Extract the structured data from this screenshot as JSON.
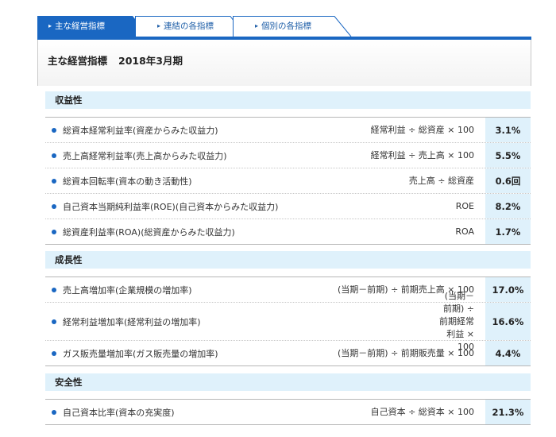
{
  "tabs": [
    {
      "label": "主な経営指標",
      "active": true
    },
    {
      "label": "連結の各指標",
      "active": false
    },
    {
      "label": "個別の各指標",
      "active": false
    }
  ],
  "header": {
    "title": "主な経営指標",
    "period": "2018年3月期"
  },
  "sections": [
    {
      "title": "収益性",
      "rows": [
        {
          "name": "総資本経常利益率(資産からみた収益力)",
          "formula": "経常利益 ÷ 総資産 × 100",
          "value": "3.1%"
        },
        {
          "name": "売上高経常利益率(売上高からみた収益力)",
          "formula": "経常利益 ÷ 売上高 × 100",
          "value": "5.5%"
        },
        {
          "name": "総資本回転率(資本の動き活動性)",
          "formula": "売上高 ÷ 総資産",
          "value": "0.6回"
        },
        {
          "name": "自己資本当期純利益率(ROE)(自己資本からみた収益力)",
          "formula": "ROE",
          "value": "8.2%"
        },
        {
          "name": "総資産利益率(ROA)(総資産からみた収益力)",
          "formula": "ROA",
          "value": "1.7%"
        }
      ]
    },
    {
      "title": "成長性",
      "rows": [
        {
          "name": "売上高増加率(企業規模の増加率)",
          "formula": "(当期－前期) ÷ 前期売上高 × 100",
          "value": "17.0%"
        },
        {
          "name": "経常利益増加率(経常利益の増加率)",
          "formula": "(当期－前期) ÷ 前期経常利益 × 100",
          "value": "16.6%"
        },
        {
          "name": "ガス販売量増加率(ガス販売量の増加率)",
          "formula": "(当期－前期) ÷ 前期販売量 × 100",
          "value": "4.4%"
        }
      ]
    },
    {
      "title": "安全性",
      "rows": [
        {
          "name": "自己資本比率(資本の充実度)",
          "formula": "自己資本 ÷ 総資本 × 100",
          "value": "21.3%"
        }
      ]
    }
  ],
  "colors": {
    "accent": "#1a67c2",
    "highlight": "#dff1fb"
  }
}
